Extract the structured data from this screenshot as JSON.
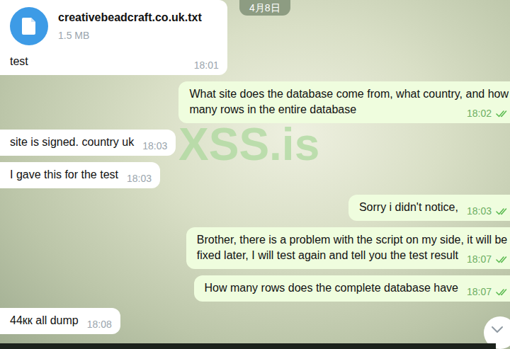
{
  "chat": {
    "date_badge": "4月8日",
    "watermark": "XSS.is",
    "messages": [
      {
        "kind": "file",
        "direction": "incoming",
        "file": {
          "name": "creativebeadcraft.co.uk.txt",
          "size": "1.5 MB"
        },
        "lines": [
          "test"
        ],
        "time": "18:01",
        "read": false
      },
      {
        "kind": "text",
        "direction": "outgoing",
        "lines": [
          "What site does the database come from, what country, and how",
          "many rows in the entire database"
        ],
        "time": "18:02",
        "read": true
      },
      {
        "kind": "text",
        "direction": "incoming",
        "lines": [
          "site is signed. country uk"
        ],
        "time": "18:03",
        "read": false
      },
      {
        "kind": "text",
        "direction": "incoming",
        "lines": [
          "I gave this for the test"
        ],
        "time": "18:03",
        "read": false
      },
      {
        "kind": "text",
        "direction": "outgoing",
        "lines": [
          "Sorry i didn't notice,"
        ],
        "time": "18:03",
        "read": true
      },
      {
        "kind": "text",
        "direction": "outgoing",
        "lines": [
          "Brother, there is a problem with the script on my side, it will be",
          "fixed later, I will test again and tell you the test result"
        ],
        "time": "18:07",
        "read": true
      },
      {
        "kind": "text",
        "direction": "outgoing",
        "lines": [
          "How many rows does the complete database have"
        ],
        "time": "18:07",
        "read": true
      },
      {
        "kind": "text",
        "direction": "incoming",
        "lines": [
          "44кк all dump"
        ],
        "time": "18:08",
        "read": false
      }
    ]
  }
}
